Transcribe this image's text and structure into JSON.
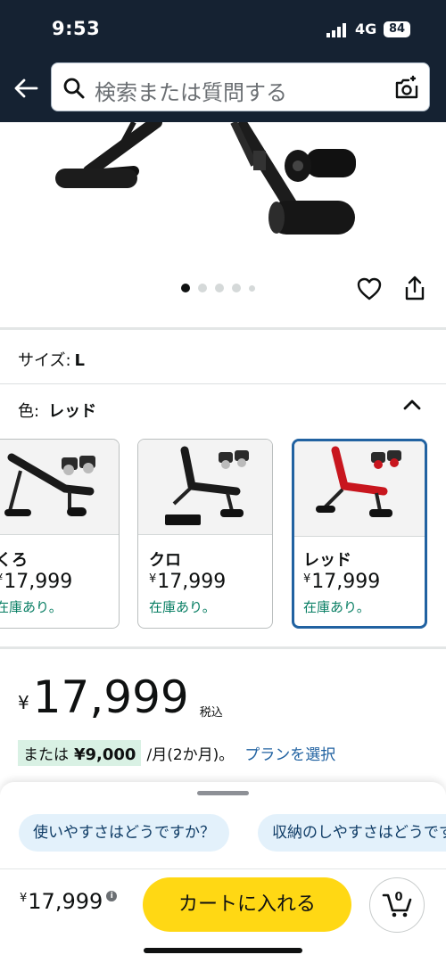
{
  "status_bar": {
    "time": "9:53",
    "network": "4G",
    "battery": "84"
  },
  "search": {
    "placeholder": "検索または質問する"
  },
  "icons": {
    "back": "arrow-left-icon",
    "search": "search-icon",
    "camera": "camera-plus-icon",
    "heart": "heart-icon",
    "share": "share-icon",
    "chevron": "chevron-up-icon",
    "cart": "cart-icon"
  },
  "carousel": {
    "count": 5,
    "active": 0
  },
  "size": {
    "label": "サイズ:",
    "value": "L"
  },
  "color": {
    "label": "色:",
    "value": "レッド"
  },
  "variants": [
    {
      "name": "くろ",
      "yen": "¥",
      "price": "17,999",
      "stock": "在庫あり。",
      "selected": false
    },
    {
      "name": "クロ",
      "yen": "¥",
      "price": "17,999",
      "stock": "在庫あり。",
      "selected": false
    },
    {
      "name": "レッド",
      "yen": "¥",
      "price": "17,999",
      "stock": "在庫あり。",
      "selected": true
    }
  ],
  "price": {
    "yen": "¥",
    "amount": "17,999",
    "tax": "税込"
  },
  "installment": {
    "prefix": "または",
    "amount": "¥9,000",
    "term": "/月(2か月)。",
    "link": "プランを選択"
  },
  "sheet": {
    "chips": [
      "使いやすさはどうですか？",
      "収納のしやすさはどうですか？"
    ],
    "yen": "¥",
    "price": "17,999",
    "cart_label": "カートに入れる",
    "cart_count": "0"
  },
  "colors": {
    "header": "#152232",
    "accent": "#ffd814",
    "link": "#2162a1",
    "stock": "#067d62",
    "selected_border": "#2162a1"
  }
}
